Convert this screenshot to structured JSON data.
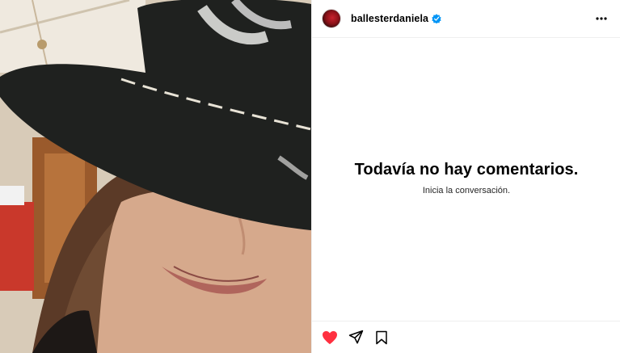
{
  "post": {
    "username": "ballesterdaniela",
    "verified": true,
    "colors": {
      "verified_badge": "#0095f6",
      "like_red": "#ff3040"
    }
  },
  "comments": {
    "empty_title": "Todavía no hay comentarios.",
    "empty_subtitle": "Inicia la conversación."
  },
  "icons": {
    "avatar": "profile-avatar",
    "verified": "verified-badge-icon",
    "more": "more-options-icon",
    "like": "heart-filled-icon",
    "share": "paper-plane-icon",
    "save": "bookmark-icon"
  },
  "state": {
    "liked": true
  }
}
